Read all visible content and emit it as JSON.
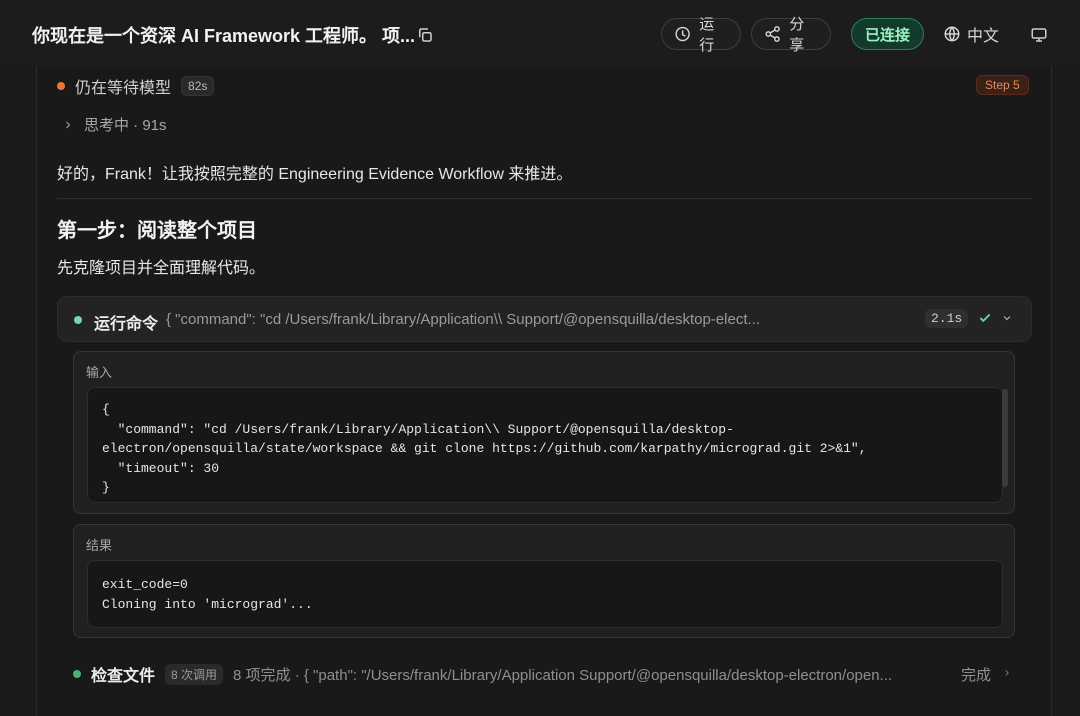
{
  "header": {
    "title": "你现在是一个资深 AI Framework 工程师。 项...",
    "run_label": "运行",
    "share_label": "分享",
    "status_label": "已连接",
    "language_label": "中文"
  },
  "status": {
    "text": "仍在等待模型",
    "elapsed": "82s",
    "step": "Step 5"
  },
  "thinking": {
    "label": "思考中 · 91s"
  },
  "message": {
    "intro": "好的，Frank！让我按照完整的 Engineering Evidence Workflow 来推进。",
    "heading": "第一步：阅读整个项目",
    "subtext": "先克隆项目并全面理解代码。"
  },
  "command": {
    "label": "运行命令",
    "preview": "{ \"command\": \"cd /Users/frank/Library/Application\\\\ Support/@opensquilla/desktop-elect...",
    "duration": "2.1s",
    "input_title": "输入",
    "input_code": "{\n  \"command\": \"cd /Users/frank/Library/Application\\\\ Support/@opensquilla/desktop-\nelectron/opensquilla/state/workspace && git clone https://github.com/karpathy/micrograd.git 2>&1\",\n  \"timeout\": 30\n}",
    "result_title": "结果",
    "result_code": "exit_code=0\nCloning into 'micrograd'..."
  },
  "inspect": {
    "label": "检查文件",
    "calls": "8 次调用",
    "preview": "8 项完成 · { \"path\": \"/Users/frank/Library/Application Support/@opensquilla/desktop-electron/open...",
    "done_label": "完成"
  },
  "colors": {
    "connected": "#9df0c4",
    "step": "#e68a57",
    "success": "#79d7a8"
  }
}
